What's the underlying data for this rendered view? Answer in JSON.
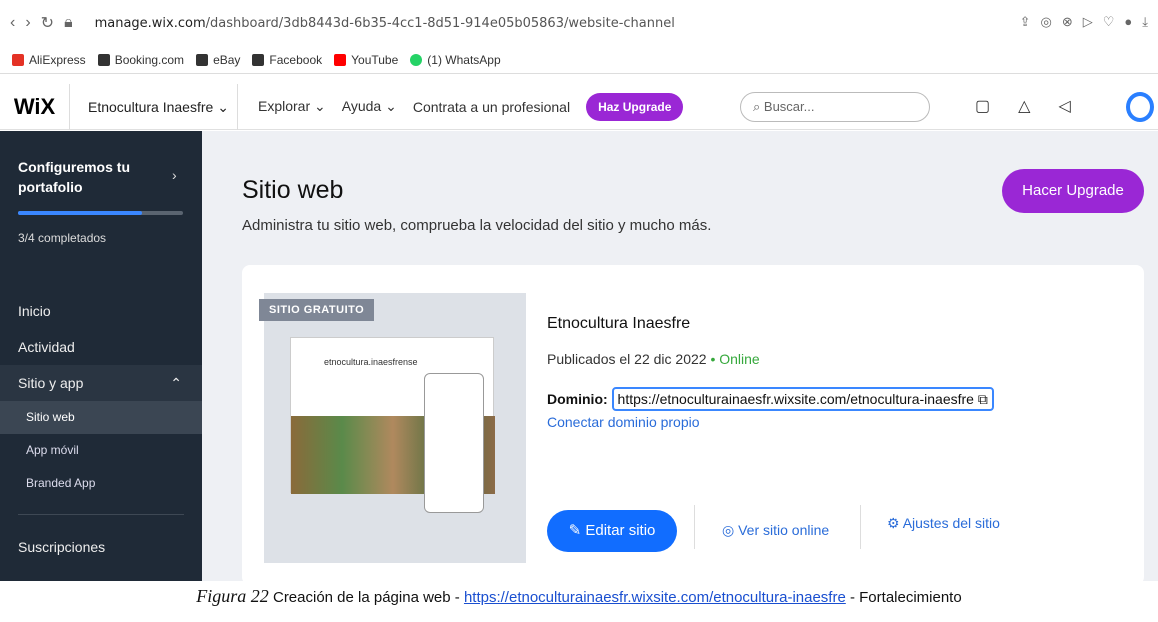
{
  "browser": {
    "url_domain": "manage.wix.com",
    "url_path": "/dashboard/3db8443d-6b35-4cc1-8d51-914e05b05863/website-channel"
  },
  "bookmarks": [
    {
      "label": "AliExpress",
      "color": "#e43225"
    },
    {
      "label": "Booking.com",
      "color": "#333333"
    },
    {
      "label": "eBay",
      "color": "#333333"
    },
    {
      "label": "Facebook",
      "color": "#333333"
    },
    {
      "label": "YouTube",
      "color": "#ff0000"
    },
    {
      "label": "(1) WhatsApp",
      "color": "#25d366"
    }
  ],
  "wix_header": {
    "logo": "WiX",
    "site_name": "Etnocultura Inaesfre",
    "nav": [
      "Explorar",
      "Ayuda",
      "Contrata a un profesional"
    ],
    "upgrade_pill": "Haz Upgrade",
    "search_placeholder": "Buscar..."
  },
  "sidebar": {
    "onboarding_title": "Configuremos tu portafolio",
    "progress_text": "3/4 completados",
    "progress_fraction": 0.75,
    "items": [
      "Inicio",
      "Actividad",
      "Sitio y app"
    ],
    "subitems": [
      "Sitio web",
      "App móvil",
      "Branded App"
    ],
    "bottom_item": "Suscripciones"
  },
  "main": {
    "title": "Sitio web",
    "subtitle": "Administra tu sitio web, comprueba la velocidad del sitio y mucho más.",
    "upgrade_button": "Hacer Upgrade",
    "tag": "SITIO GRATUITO",
    "thumb_title": "etnocultura.inaesfrense",
    "site_name": "Etnocultura Inaesfre",
    "published": "Publicados el 22 dic 2022",
    "status": "Online",
    "domain_label": "Dominio:",
    "domain_url": "https://etnoculturainaesfr.wixsite.com/etnocultura-inaesfre",
    "connect_domain": "Conectar dominio propio",
    "edit_button": "Editar sitio",
    "view_online": "Ver sitio online",
    "settings": "Ajustes del sitio"
  },
  "caption": {
    "figure": "Figura 22",
    "text": "Creación de la página web -",
    "link": "https://etnoculturainaesfr.wixsite.com/etnocultura-inaesfre",
    "suffix": "- Fortalecimiento"
  }
}
